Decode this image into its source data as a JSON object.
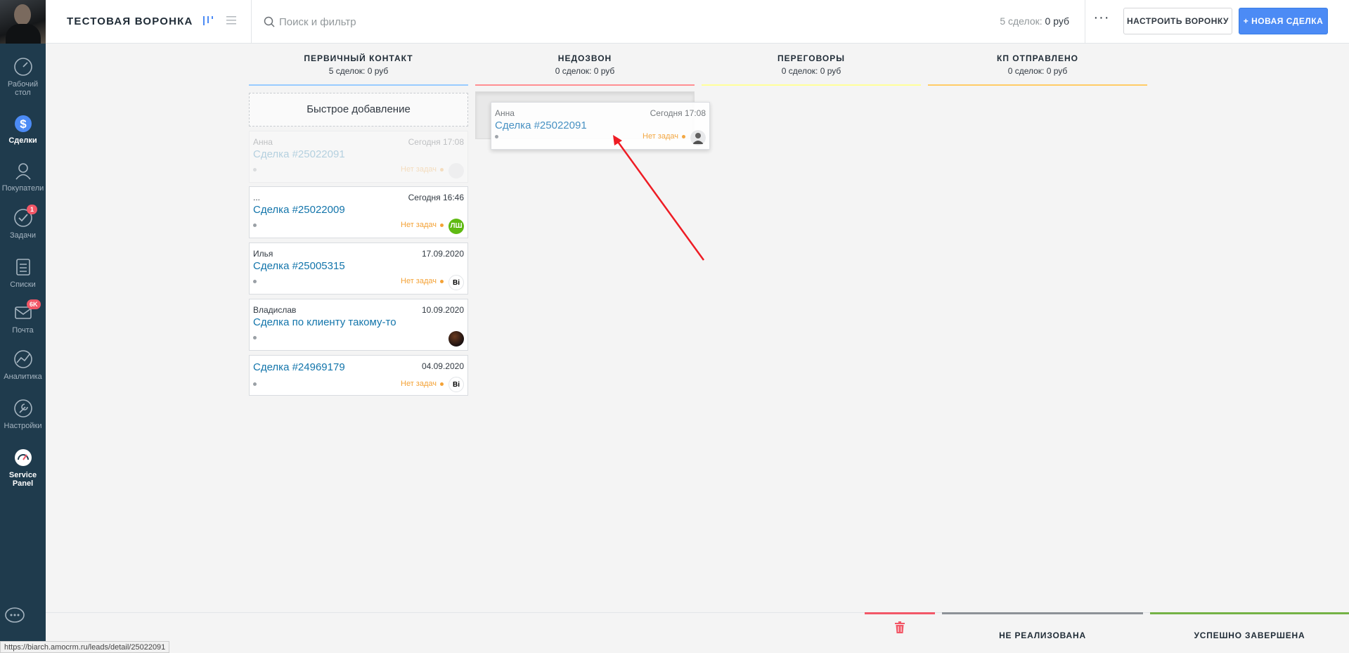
{
  "sidebar": {
    "items": [
      {
        "label": "Рабочий стол",
        "icon": "dashboard-icon"
      },
      {
        "label": "Сделки",
        "icon": "deals-icon",
        "active": true
      },
      {
        "label": "Покупатели",
        "icon": "customers-icon"
      },
      {
        "label": "Задачи",
        "icon": "tasks-icon",
        "badge": "1"
      },
      {
        "label": "Списки",
        "icon": "lists-icon"
      },
      {
        "label": "Почта",
        "icon": "mail-icon",
        "badge": "6K"
      },
      {
        "label": "Аналитика",
        "icon": "analytics-icon"
      },
      {
        "label": "Настройки",
        "icon": "settings-icon"
      },
      {
        "label": "Service Panel",
        "icon": "service-panel-icon"
      }
    ]
  },
  "header": {
    "title": "ТЕСТОВАЯ ВОРОНКА",
    "search_placeholder": "Поиск и фильтр",
    "summary_count": "5 сделок:",
    "summary_amount": "0 руб",
    "more_label": "···",
    "setup_button": "НАСТРОИТЬ ВОРОНКУ",
    "new_button": "+ НОВАЯ СДЕЛКА"
  },
  "columns": [
    {
      "name": "ПЕРВИЧНЫЙ КОНТАКТ",
      "count": "5 сделок:",
      "amount": "0 руб",
      "color": "#99ccff"
    },
    {
      "name": "НЕДОЗВОН",
      "count": "0 сделок:",
      "amount": "0 руб",
      "color": "#ff8f92"
    },
    {
      "name": "ПЕРЕГОВОРЫ",
      "count": "0 сделок:",
      "amount": "0 руб",
      "color": "#ffff99"
    },
    {
      "name": "КП ОТПРАВЛЕНО",
      "count": "0 сделок:",
      "amount": "0 руб",
      "color": "#ffcc66"
    }
  ],
  "quick_add": "Быстрое добавление",
  "cards": [
    {
      "who": "Анна",
      "date": "Сегодня 17:08",
      "name": "Сделка #25022091",
      "task": "Нет задач",
      "avatar": ""
    },
    {
      "who": "...",
      "date": "Сегодня 16:46",
      "name": "Сделка #25022009",
      "task": "Нет задач",
      "avatar": "ЛШ"
    },
    {
      "who": "Илья",
      "date": "17.09.2020",
      "name": "Сделка #25005315",
      "task": "Нет задач",
      "avatar": "Bi"
    },
    {
      "who": "Владислав",
      "date": "10.09.2020",
      "name": "Сделка по клиенту такому-то",
      "task": "",
      "avatar": ""
    },
    {
      "who": "",
      "date": "04.09.2020",
      "name": "Сделка #24969179",
      "task": "Нет задач",
      "avatar": "Bi"
    }
  ],
  "dragged_card": {
    "who": "Анна",
    "date": "Сегодня 17:08",
    "name": "Сделка #25022091",
    "task": "Нет задач"
  },
  "bottom": {
    "fail_label": "НЕ РЕАЛИЗОВАНА",
    "win_label": "УСПЕШНО ЗАВЕРШЕНА"
  },
  "status_url": "https://biarch.amocrm.ru/leads/detail/25022091",
  "colors": {
    "accent": "#4c8bf5",
    "sidebar": "#1f3b4d",
    "link": "#1375ab",
    "task": "#f4a236"
  }
}
